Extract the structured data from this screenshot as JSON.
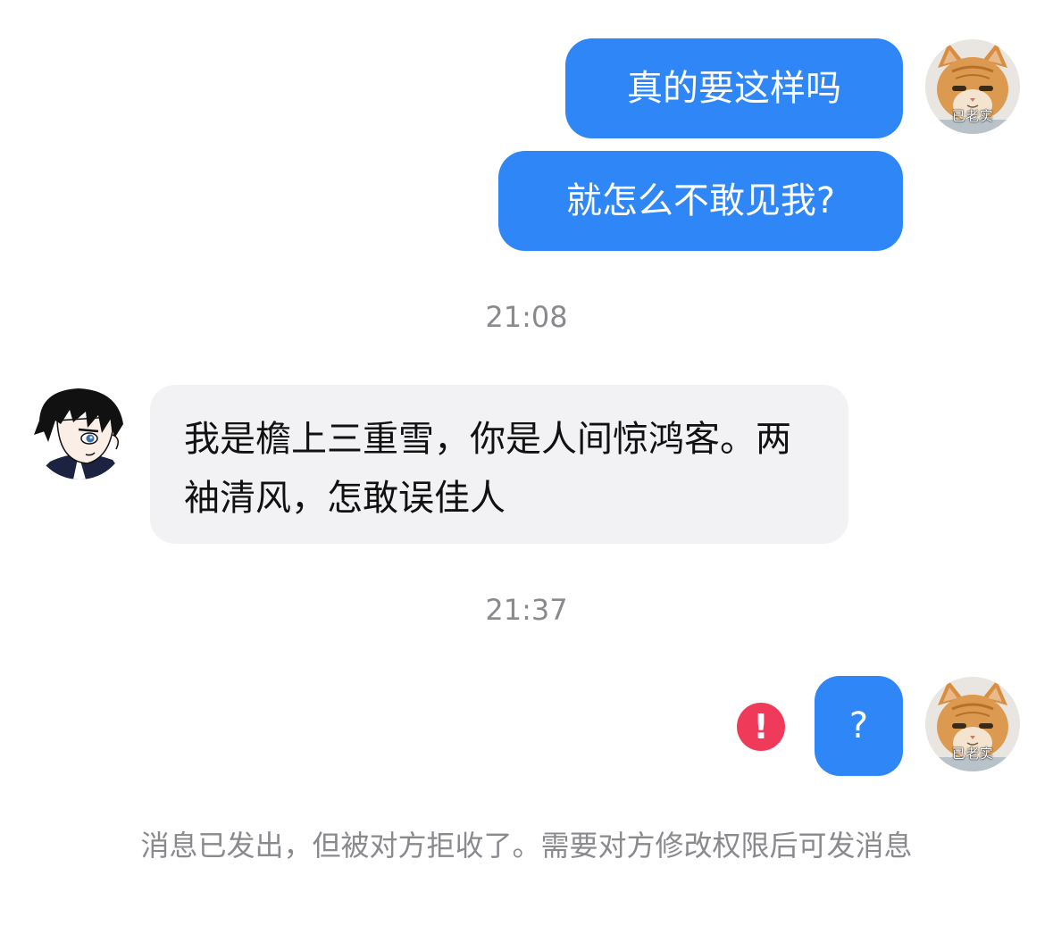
{
  "messages": {
    "out_1": "真的要这样吗",
    "out_2": "就怎么不敢见我?",
    "in_1": "我是檐上三重雪，你是人间惊鸿客。两袖清风，怎敢误佳人",
    "out_3": "?"
  },
  "timestamps": {
    "t1": "21:08",
    "t2": "21:37"
  },
  "avatars": {
    "self_caption": "已老实"
  },
  "status": {
    "error_glyph": "!",
    "rejected_notice": "消息已发出，但被对方拒收了。需要对方修改权限后可发消息"
  },
  "colors": {
    "outgoing_bubble": "#2f86f6",
    "incoming_bubble": "#f2f2f4",
    "error": "#f03a5a",
    "meta_text": "#8a8a8e"
  }
}
